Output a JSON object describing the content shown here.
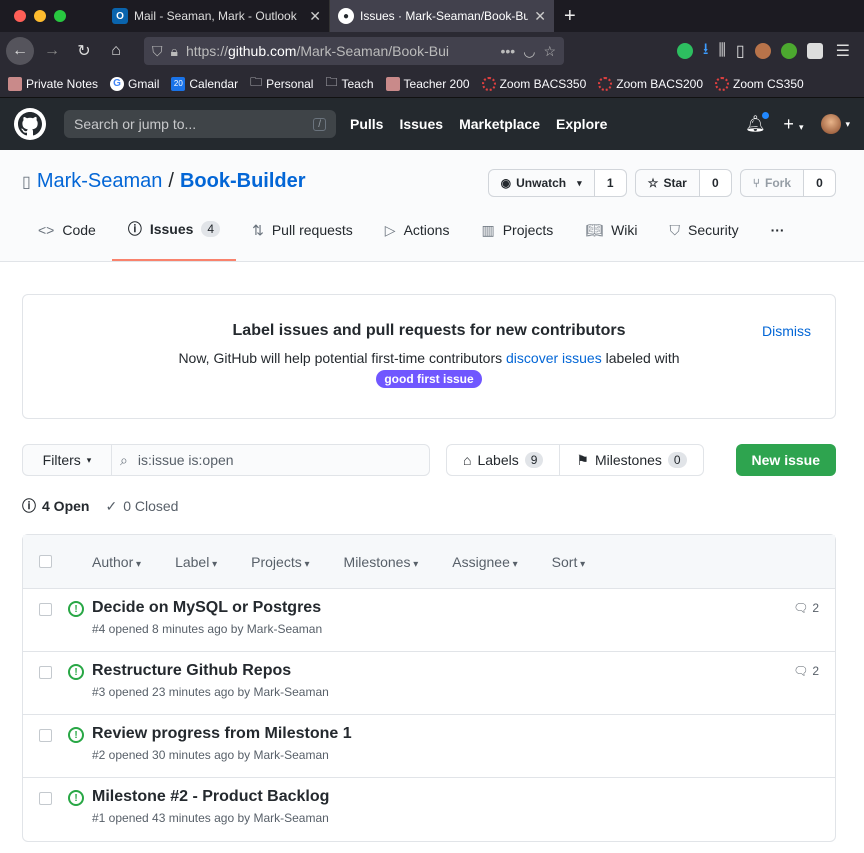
{
  "browser": {
    "tabs": [
      {
        "title": "Mail - Seaman, Mark - Outlook",
        "icon": "outlook-icon"
      },
      {
        "title": "Issues · Mark-Seaman/Book-Bu",
        "icon": "github-icon"
      }
    ],
    "url_prefix": "https://",
    "url_host": "github.com",
    "url_path": "/Mark-Seaman/Book-Bui",
    "bookmarks": [
      {
        "label": "Private Notes"
      },
      {
        "label": "Gmail"
      },
      {
        "label": "Calendar"
      },
      {
        "label": "Personal"
      },
      {
        "label": "Teach"
      },
      {
        "label": "Teacher 200"
      },
      {
        "label": "Zoom BACS350"
      },
      {
        "label": "Zoom BACS200"
      },
      {
        "label": "Zoom CS350"
      }
    ],
    "calendar_day": "20"
  },
  "gh": {
    "search_placeholder": "Search or jump to...",
    "search_key": "/",
    "nav": [
      "Pulls",
      "Issues",
      "Marketplace",
      "Explore"
    ]
  },
  "repo": {
    "owner": "Mark-Seaman",
    "sep": "/",
    "name": "Book-Builder",
    "watch_label": "Unwatch",
    "watch_count": "1",
    "star_label": "Star",
    "star_count": "0",
    "fork_label": "Fork",
    "fork_count": "0",
    "tabs": [
      {
        "label": "Code"
      },
      {
        "label": "Issues",
        "count": "4"
      },
      {
        "label": "Pull requests"
      },
      {
        "label": "Actions"
      },
      {
        "label": "Projects"
      },
      {
        "label": "Wiki"
      },
      {
        "label": "Security"
      }
    ],
    "more": "···"
  },
  "banner": {
    "heading": "Label issues and pull requests for new contributors",
    "text_before": "Now, GitHub will help potential first-time contributors ",
    "link": "discover issues",
    "text_after": " labeled with",
    "label": "good first issue",
    "dismiss": "Dismiss"
  },
  "toolbar": {
    "filters": "Filters",
    "query": "is:issue is:open",
    "labels": "Labels",
    "labels_count": "9",
    "milestones": "Milestones",
    "milestones_count": "0",
    "new_issue": "New issue"
  },
  "states": {
    "open": "4 Open",
    "closed": "0 Closed"
  },
  "list_head": [
    "Author",
    "Label",
    "Projects",
    "Milestones",
    "Assignee",
    "Sort"
  ],
  "issues": [
    {
      "title": "Decide on MySQL or Postgres",
      "meta": "#4 opened 8 minutes ago by Mark-Seaman",
      "comments": "2"
    },
    {
      "title": "Restructure Github Repos",
      "meta": "#3 opened 23 minutes ago by Mark-Seaman",
      "comments": "2"
    },
    {
      "title": "Review progress from Milestone 1",
      "meta": "#2 opened 30 minutes ago by Mark-Seaman",
      "comments": ""
    },
    {
      "title": "Milestone #2 - Product Backlog",
      "meta": "#1 opened 43 minutes ago by Mark-Seaman",
      "comments": ""
    }
  ],
  "colors": {
    "green": "#2ea44f",
    "link": "#0366d6",
    "label": "#7057ff",
    "header": "#24292e"
  }
}
